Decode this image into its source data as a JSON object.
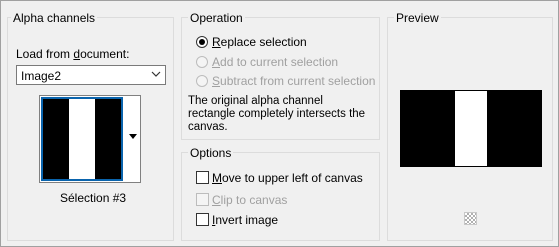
{
  "alpha": {
    "title": "Alpha channels",
    "load_label_pre": "Load from ",
    "load_label_key": "d",
    "load_label_post": "ocument:",
    "document_value": "Image2",
    "selection_name": "Sélection #3"
  },
  "operation": {
    "title": "Operation",
    "options": [
      {
        "pre": "",
        "key": "R",
        "post": "eplace selection",
        "selected": true,
        "enabled": true
      },
      {
        "pre": "",
        "key": "A",
        "post": "dd to current selection",
        "selected": false,
        "enabled": false
      },
      {
        "pre": "",
        "key": "S",
        "post": "ubtract from current selection",
        "selected": false,
        "enabled": false
      }
    ],
    "message": "The original alpha channel rectangle completely intersects the canvas."
  },
  "options": {
    "title": "Options",
    "move": {
      "pre": "",
      "key": "M",
      "post": "ove to upper left of canvas",
      "checked": false,
      "enabled": true
    },
    "clip": {
      "pre": "",
      "key": "C",
      "post": "lip to canvas",
      "checked": false,
      "enabled": false
    },
    "invert": {
      "pre": "",
      "key": "I",
      "post": "nvert image",
      "checked": false,
      "enabled": true
    }
  },
  "preview": {
    "title": "Preview",
    "background_icon": "checkerboard-icon"
  },
  "colors": {
    "selection_border": "#0a64ad",
    "dialog_bg": "#f0f0f0"
  }
}
